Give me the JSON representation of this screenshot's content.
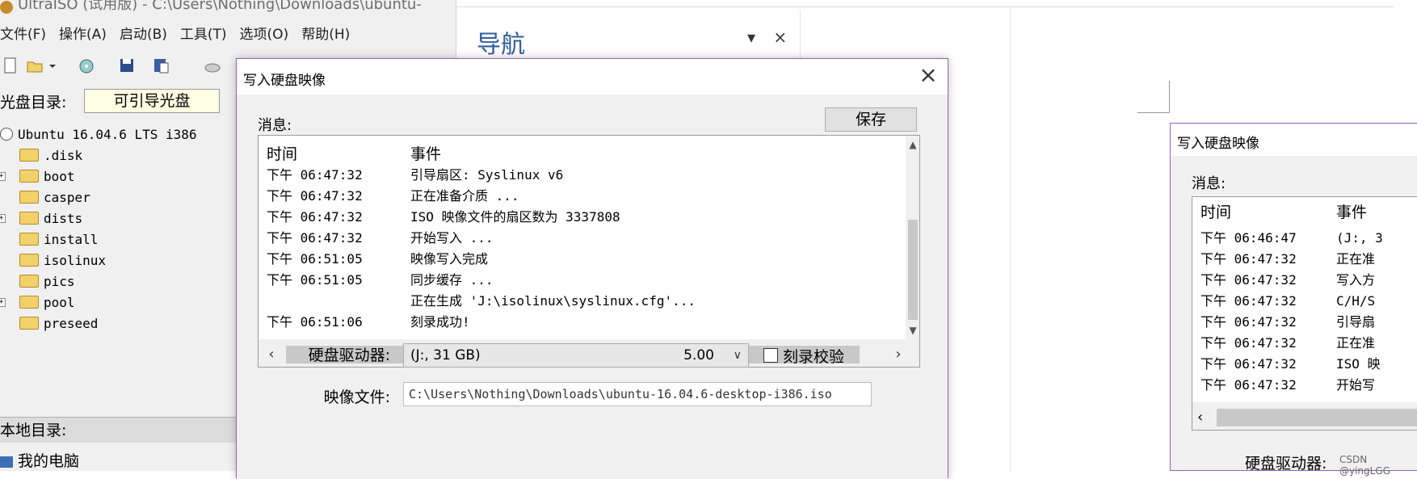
{
  "main_window": {
    "title": "UltraISO (试用版) - C:\\Users\\Nothing\\Downloads\\ubuntu-",
    "menu": [
      "文件(F)",
      "操作(A)",
      "启动(B)",
      "工具(T)",
      "选项(O)",
      "帮助(H)"
    ],
    "cd_dir_label": "光盘目录:",
    "cd_dir_value": "可引导光盘",
    "tree_root": "Ubuntu 16.04.6 LTS i386",
    "tree_items": [
      ".disk",
      "boot",
      "casper",
      "dists",
      "install",
      "isolinux",
      "pics",
      "pool",
      "preseed"
    ],
    "local_dir_label": "本地目录:",
    "local_root": "我的电脑"
  },
  "nav_pane": {
    "title": "导航",
    "controls": "▾ ×"
  },
  "write_dialog": {
    "title": "写入硬盘映像",
    "close": "×",
    "messages_label": "消息:",
    "save_button": "保存",
    "columns": {
      "time": "时间",
      "event": "事件"
    },
    "log": [
      {
        "time": "下午 06:47:32",
        "event": "引导扇区: Syslinux v6"
      },
      {
        "time": "下午 06:47:32",
        "event": "正在准备介质 ..."
      },
      {
        "time": "下午 06:47:32",
        "event": "ISO 映像文件的扇区数为 3337808"
      },
      {
        "time": "下午 06:47:32",
        "event": "开始写入 ..."
      },
      {
        "time": "下午 06:51:05",
        "event": "映像写入完成"
      },
      {
        "time": "下午 06:51:05",
        "event": "同步缓存 ..."
      },
      {
        "time": "",
        "event": "正在生成 'J:\\isolinux\\syslinux.cfg'..."
      },
      {
        "time": "下午 06:51:06",
        "event": "刻录成功!"
      }
    ],
    "drive_label": "硬盘驱动器:",
    "drive_value": "(J:, 31 GB)",
    "drive_size": "5.00",
    "verify_label": "刻录校验",
    "image_label": "映像文件:",
    "image_value": "C:\\Users\\Nothing\\Downloads\\ubuntu-16.04.6-desktop-i386.iso"
  },
  "write_dialog_2": {
    "title": "写入硬盘映像",
    "messages_label": "消息:",
    "columns": {
      "time": "时间",
      "event": "事件"
    },
    "log": [
      {
        "time": "下午 06:46:47",
        "event": "(J:, 3"
      },
      {
        "time": "下午 06:47:32",
        "event": "正在准"
      },
      {
        "time": "下午 06:47:32",
        "event": "写入方"
      },
      {
        "time": "下午 06:47:32",
        "event": "C/H/S"
      },
      {
        "time": "下午 06:47:32",
        "event": "引导扇"
      },
      {
        "time": "下午 06:47:32",
        "event": "正在准"
      },
      {
        "time": "下午 06:47:32",
        "event": "ISO 映"
      },
      {
        "time": "下午 06:47:32",
        "event": "开始写"
      }
    ],
    "drive_label": "硬盘驱动器:"
  },
  "watermark": "CSDN @yingLGG"
}
